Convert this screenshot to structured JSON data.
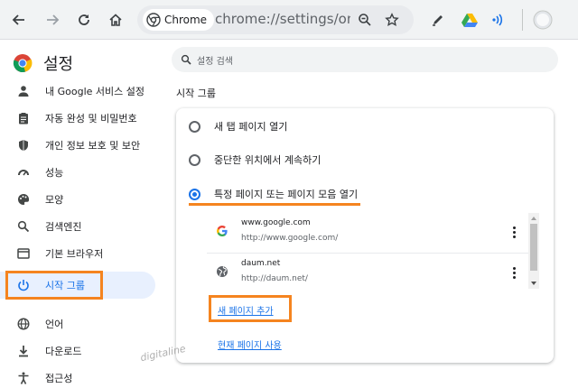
{
  "toolbar": {
    "chip_label": "Chrome",
    "url": "chrome://settings/onS..."
  },
  "sidebar": {
    "title": "설정",
    "items": [
      {
        "label": "내 Google 서비스 설정",
        "icon": "person-icon"
      },
      {
        "label": "자동 완성 및 비밀번호",
        "icon": "clipboard-icon"
      },
      {
        "label": "개인 정보 보호 및 보안",
        "icon": "shield-icon"
      },
      {
        "label": "성능",
        "icon": "speedometer-icon"
      },
      {
        "label": "모양",
        "icon": "palette-icon"
      },
      {
        "label": "검색엔진",
        "icon": "search-icon"
      },
      {
        "label": "기본 브라우저",
        "icon": "browser-icon"
      },
      {
        "label": "시작 그룹",
        "icon": "power-icon",
        "active": true
      },
      {
        "label": "언어",
        "icon": "globe-icon"
      },
      {
        "label": "다운로드",
        "icon": "download-icon"
      },
      {
        "label": "접근성",
        "icon": "accessibility-icon"
      }
    ]
  },
  "search": {
    "placeholder": "설정 검색"
  },
  "section_title": "시작 그룹",
  "options": [
    {
      "label": "새 탭 페이지 열기",
      "checked": false
    },
    {
      "label": "중단한 위치에서 계속하기",
      "checked": false
    },
    {
      "label": "특정 페이지 또는 페이지 모음 열기",
      "checked": true
    }
  ],
  "pages": [
    {
      "name": "www.google.com",
      "url": "http://www.google.com/",
      "favicon": "google-favicon"
    },
    {
      "name": "daum.net",
      "url": "http://daum.net/",
      "favicon": "globe-favicon"
    }
  ],
  "links": {
    "add_page": "새 페이지 추가",
    "use_current": "현재 페이지 사용"
  },
  "watermark": "digitaline",
  "colors": {
    "accent": "#1a73e8",
    "highlight": "#f5841f",
    "active_bg": "#e8f0fe"
  }
}
